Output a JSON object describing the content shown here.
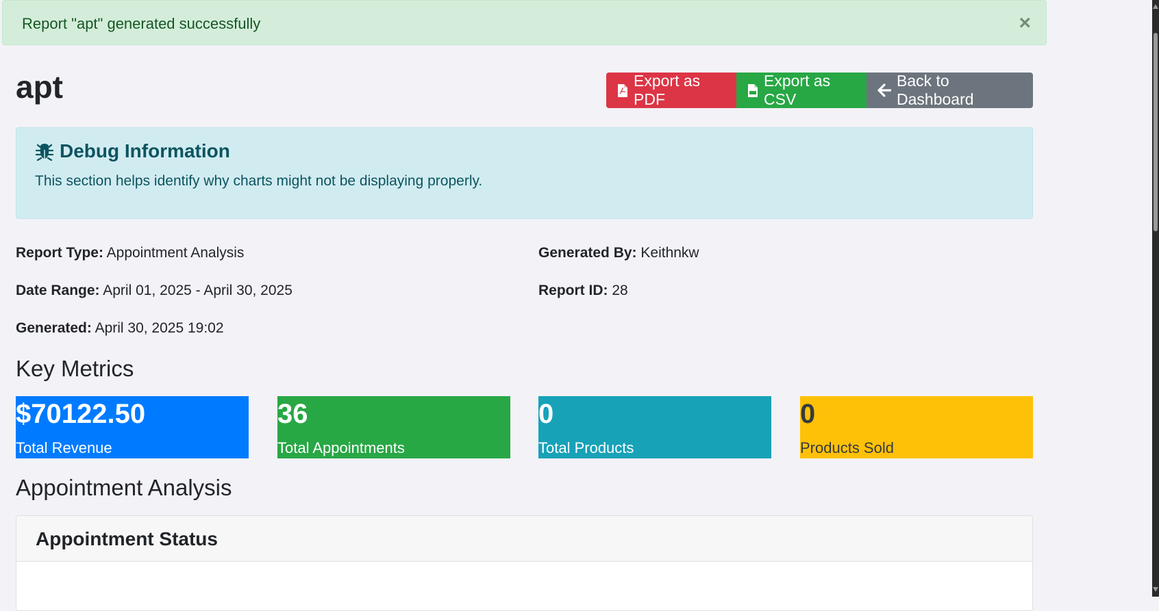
{
  "alert": {
    "message": "Report \"apt\" generated successfully",
    "close": "×"
  },
  "report": {
    "title": "apt"
  },
  "actions": {
    "export_pdf": "Export as PDF",
    "export_csv": "Export as CSV",
    "back": "Back to Dashboard"
  },
  "debug": {
    "title": "Debug Information",
    "description": "This section helps identify why charts might not be displaying properly.",
    "icon": "bug-icon"
  },
  "details": {
    "report_type": {
      "label": "Report Type:",
      "value": "Appointment Analysis"
    },
    "generated_by": {
      "label": "Generated By:",
      "value": "Keithnkw"
    },
    "date_range": {
      "label": "Date Range:",
      "value": "April 01, 2025 - April 30, 2025"
    },
    "report_id": {
      "label": "Report ID:",
      "value": "28"
    },
    "generated": {
      "label": "Generated:",
      "value": "April 30, 2025 19:02"
    }
  },
  "key_metrics": {
    "title": "Key Metrics",
    "items": [
      {
        "value": "$70122.50",
        "label": "Total Revenue",
        "color": "#007bff"
      },
      {
        "value": "36",
        "label": "Total Appointments",
        "color": "#28a745"
      },
      {
        "value": "0",
        "label": "Total Products",
        "color": "#17a2b8"
      },
      {
        "value": "0",
        "label": "Products Sold",
        "color": "#ffc107"
      }
    ]
  },
  "analysis": {
    "title": "Appointment Analysis",
    "card_title": "Appointment Status"
  },
  "colors": {
    "success_bg": "#d4edda",
    "danger": "#dc3545",
    "success": "#28a745",
    "secondary": "#6c757d",
    "info_bg": "#d1ecf1"
  }
}
